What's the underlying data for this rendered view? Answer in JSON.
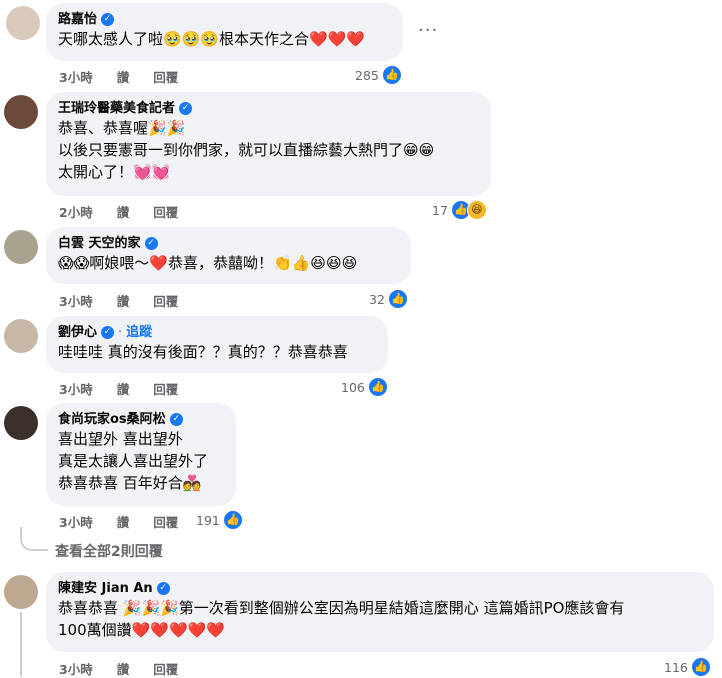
{
  "comments": [
    {
      "name": "路嘉怡",
      "follow": "",
      "lines": [
        "天哪太感人了啦🥹🥹🥹根本天作之合❤️❤️❤️"
      ],
      "time": "3小時",
      "like": "讚",
      "reply": "回覆",
      "count": "285",
      "reaction": "like",
      "avatar_color": "#d9c9bb"
    },
    {
      "name": "王瑞玲醫藥美食記者",
      "follow": "",
      "lines": [
        "恭喜、恭喜喔🎉🎉",
        "以後只要憲哥一到你們家，就可以直播綜藝大熱門了😁😁",
        "太開心了！💓💓"
      ],
      "time": "2小時",
      "like": "讚",
      "reply": "回覆",
      "count": "17",
      "reaction": "like-haha",
      "avatar_color": "#6b4a3a"
    },
    {
      "name": "白雲 天空的家",
      "follow": "",
      "lines": [
        "😱😱啊娘喂～❤️恭喜，恭囍呦！👏👍😆😆😆"
      ],
      "time": "3小時",
      "like": "讚",
      "reply": "回覆",
      "count": "32",
      "reaction": "like",
      "avatar_color": "#a9a28e"
    },
    {
      "name": "劉伊心",
      "follow": "追蹤",
      "lines": [
        "哇哇哇 真的沒有後面？？真的？？恭喜恭喜"
      ],
      "time": "3小時",
      "like": "讚",
      "reply": "回覆",
      "count": "106",
      "reaction": "like",
      "avatar_color": "#c7b5a6"
    },
    {
      "name": "食尚玩家os桑阿松",
      "follow": "",
      "lines": [
        "喜出望外 喜出望外",
        "真是太讓人喜出望外了",
        "恭喜恭喜 百年好合💑"
      ],
      "time": "3小時",
      "like": "讚",
      "reply": "回覆",
      "count": "191",
      "reaction": "like",
      "avatar_color": "#3a2f2a"
    },
    {
      "name": "陳建安 Jian An",
      "follow": "",
      "lines": [
        "恭喜恭喜 🎉🎉🎉第一次看到整個辦公室因為明星結婚這麼開心 這篇婚訊PO應該會有",
        "100萬個讚❤️❤️❤️❤️❤️"
      ],
      "time": "3小時",
      "like": "讚",
      "reply": "回覆",
      "count": "116",
      "reaction": "like",
      "avatar_color": "#bfa890"
    }
  ],
  "view_replies": "查看全部2則回覆",
  "more_label": "···",
  "icons": {
    "verified": "verified-badge-icon",
    "like": "thumbs-up-icon",
    "haha": "laughing-face-icon",
    "more": "more-options-icon"
  },
  "colors": {
    "accent": "#1877f2",
    "bubble": "#f0f2f5",
    "secondary_text": "#65676b"
  }
}
